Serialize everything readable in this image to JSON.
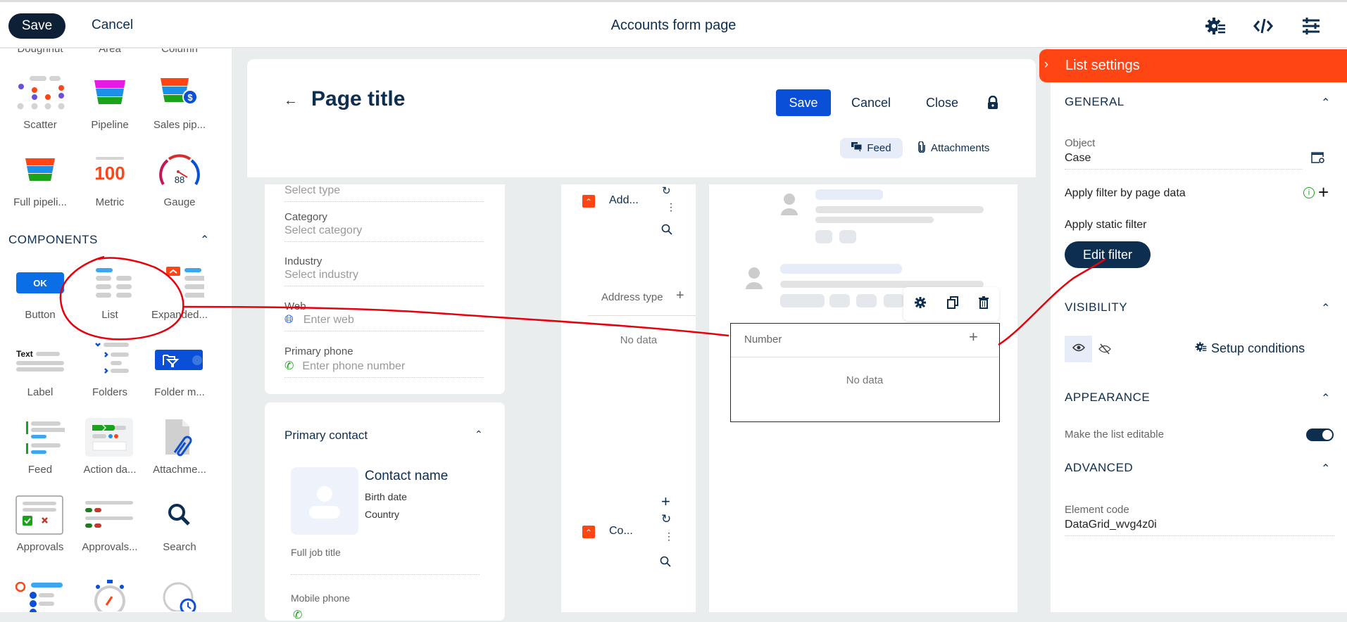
{
  "topbar": {
    "save_label": "Save",
    "cancel_label": "Cancel",
    "title": "Accounts form page",
    "icons": [
      "gear-list-icon",
      "code-icon",
      "sliders-icon"
    ]
  },
  "palette": {
    "partial_row_labels": [
      "Doughnut",
      "Area",
      "Column"
    ],
    "charts": [
      {
        "label": "Scatter",
        "icon": "scatter-icon"
      },
      {
        "label": "Pipeline",
        "icon": "pipeline-icon"
      },
      {
        "label": "Sales pip...",
        "icon": "sales-pipeline-icon"
      },
      {
        "label": "Full pipeli...",
        "icon": "full-pipeline-icon"
      },
      {
        "label": "Metric",
        "icon": "metric-icon",
        "value": "100"
      },
      {
        "label": "Gauge",
        "icon": "gauge-icon",
        "value": "88"
      }
    ],
    "components_heading": "COMPONENTS",
    "components": [
      {
        "label": "Button",
        "icon": "button-icon",
        "text": "OK"
      },
      {
        "label": "List",
        "icon": "list-icon"
      },
      {
        "label": "Expanded...",
        "icon": "expanded-list-icon"
      },
      {
        "label": "Label",
        "icon": "label-icon",
        "text": "Text"
      },
      {
        "label": "Folders",
        "icon": "folders-icon"
      },
      {
        "label": "Folder m...",
        "icon": "folder-manager-icon"
      },
      {
        "label": "Feed",
        "icon": "feed-icon"
      },
      {
        "label": "Action da...",
        "icon": "action-dashboard-icon"
      },
      {
        "label": "Attachme...",
        "icon": "attachments-icon"
      },
      {
        "label": "Approvals",
        "icon": "approvals-icon"
      },
      {
        "label": "Approvals...",
        "icon": "approvals-list-icon"
      },
      {
        "label": "Search",
        "icon": "search-icon"
      }
    ]
  },
  "page": {
    "title": "Page title",
    "save_label": "Save",
    "cancel_label": "Cancel",
    "close_label": "Close",
    "tabs": [
      "Feed",
      "Attachments"
    ]
  },
  "form": {
    "type_placeholder": "Select type",
    "fields": [
      {
        "label": "Category",
        "placeholder": "Select category"
      },
      {
        "label": "Industry",
        "placeholder": "Select industry"
      },
      {
        "label": "Web",
        "placeholder": "Enter web"
      },
      {
        "label": "Primary phone",
        "placeholder": "Enter phone number"
      }
    ],
    "contact": {
      "heading": "Primary contact",
      "name": "Contact name",
      "birth": "Birth date",
      "country": "Country",
      "job": "Full job title",
      "mobile": "Mobile phone"
    }
  },
  "middle": {
    "addresses_title": "Add...",
    "address_col": "Address type",
    "no_data": "No data",
    "contacts_title": "Co..."
  },
  "list_widget": {
    "column": "Number",
    "no_data": "No data"
  },
  "settings": {
    "title": "List settings",
    "general": "GENERAL",
    "object_label": "Object",
    "object_value": "Case",
    "filter_page_data": "Apply filter by page data",
    "static_filter": "Apply static filter",
    "edit_filter": "Edit filter",
    "visibility": "VISIBILITY",
    "setup_conditions": "Setup conditions",
    "appearance": "APPEARANCE",
    "editable_label": "Make the list editable",
    "editable_on": true,
    "advanced": "ADVANCED",
    "element_code_label": "Element code",
    "element_code_value": "DataGrid_wvg4z0i"
  },
  "colors": {
    "accent": "#ff4513",
    "primary": "#0d2e4e",
    "blue": "#0a4fd7",
    "annotation": "#e8000b"
  }
}
